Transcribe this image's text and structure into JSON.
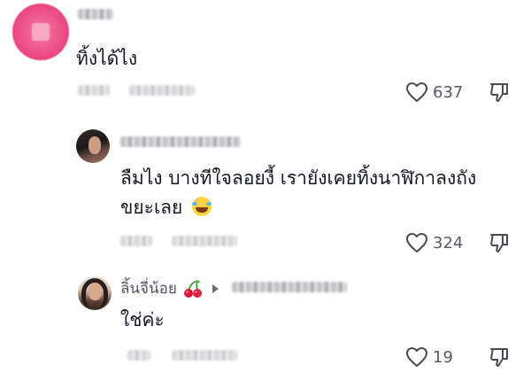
{
  "comment_main": {
    "text": "ทิ้งได้ไง",
    "likes": "637"
  },
  "reply_1": {
    "text_line1": "ลืมไง บางทีใจลอยงี้ เรายังเคยทิ้งนาฬิกาลงถัง",
    "text_line2": "ขยะเลย",
    "likes": "324"
  },
  "reply_2": {
    "username": "ลิ้นจี่น้อย",
    "text": "ใช่ค่ะ",
    "likes": "19"
  },
  "colors": {
    "accent_avatar": "#ec4f86",
    "text": "#161823",
    "meta": "#5a5a62"
  }
}
